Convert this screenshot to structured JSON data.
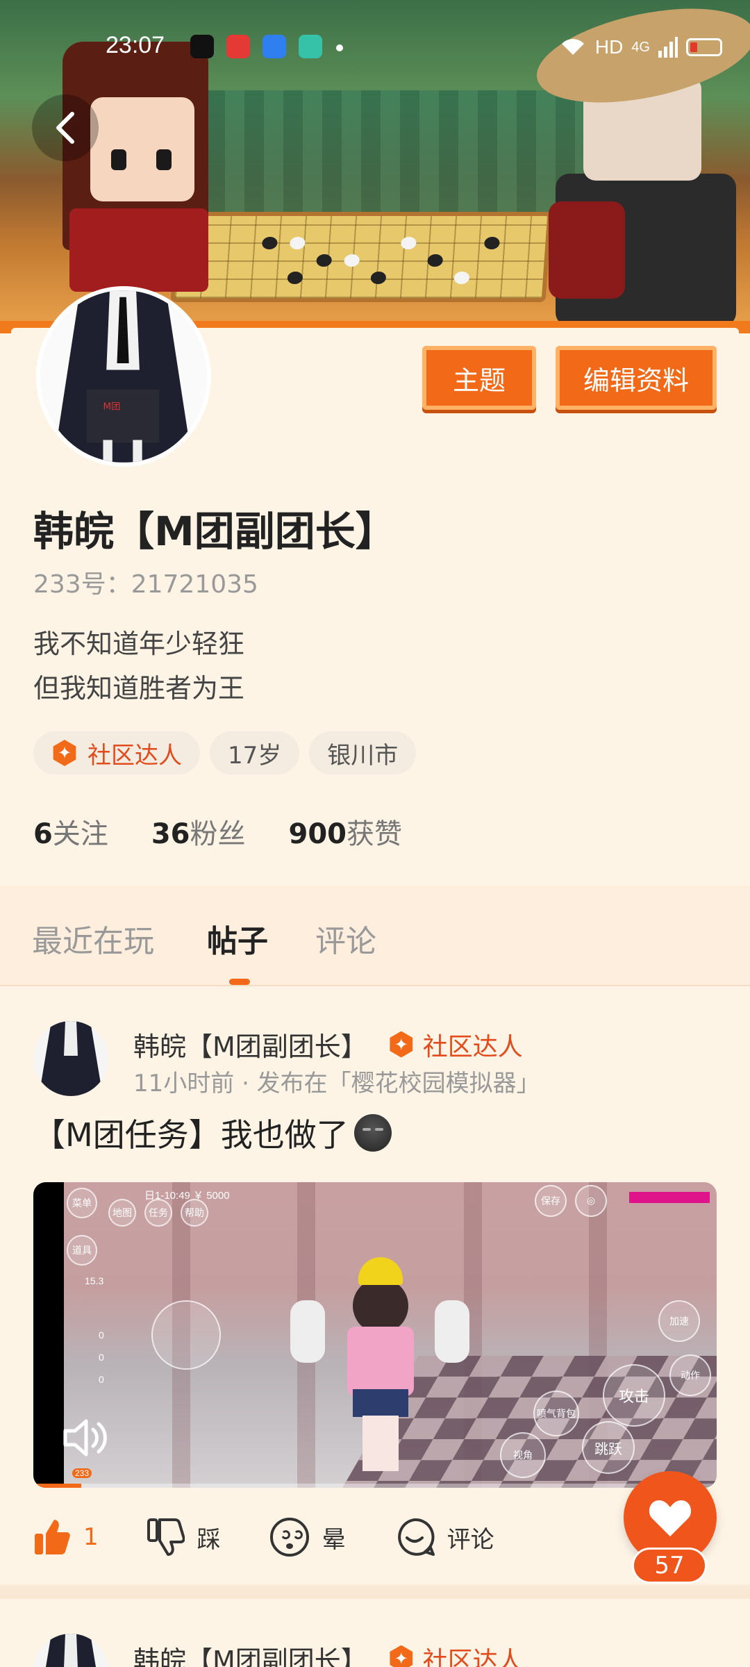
{
  "status_bar": {
    "time": "23:07",
    "network": "HD",
    "signal": "4G"
  },
  "header": {
    "back_icon": "chevron-left-icon"
  },
  "profile": {
    "avatar_mark": "M团",
    "theme_button": "主题",
    "edit_button": "编辑资料",
    "name": "韩皖【M团副团长】",
    "uid": "233号：21721035",
    "bio_line1": "我不知道年少轻狂",
    "bio_line2": "但我知道胜者为王",
    "tags": {
      "badge": "社区达人",
      "age": "17岁",
      "city": "银川市"
    },
    "stats": {
      "following_count": "6",
      "following_label": "关注",
      "followers_count": "36",
      "followers_label": "粉丝",
      "likes_count": "900",
      "likes_label": "获赞"
    }
  },
  "tabs": {
    "recent": "最近在玩",
    "posts": "帖子",
    "comments": "评论"
  },
  "post": {
    "author": "韩皖【M团副团长】",
    "badge": "社区达人",
    "meta": "11小时前 · 发布在「樱花校园模拟器」",
    "title": "【M团任务】我也做了",
    "video_hud": {
      "time_money": "日1-10:49 ￥ 5000",
      "menu": "菜单",
      "map": "地图",
      "task": "任务",
      "tools": "道具",
      "help": "帮助",
      "save": "保存",
      "stat": "15.3",
      "attack": "攻击",
      "jump": "跳跃",
      "view": "视角",
      "action": "动作",
      "accelerate": "加速",
      "jet": "喷气背包",
      "zero1": "0",
      "zero2": "0",
      "zero3": "0",
      "logo": "233",
      "progress_ratio": 0.07
    },
    "actions": {
      "like_count": "1",
      "dislike": "踩",
      "dizzy": "晕",
      "comment": "评论"
    },
    "heart_count": "57"
  },
  "post2": {
    "author": "韩皖【M团副团长】",
    "badge": "社区达人"
  },
  "colors": {
    "accent": "#f26a18",
    "background": "#fdf4e6",
    "badge_text": "#e24b1c"
  }
}
